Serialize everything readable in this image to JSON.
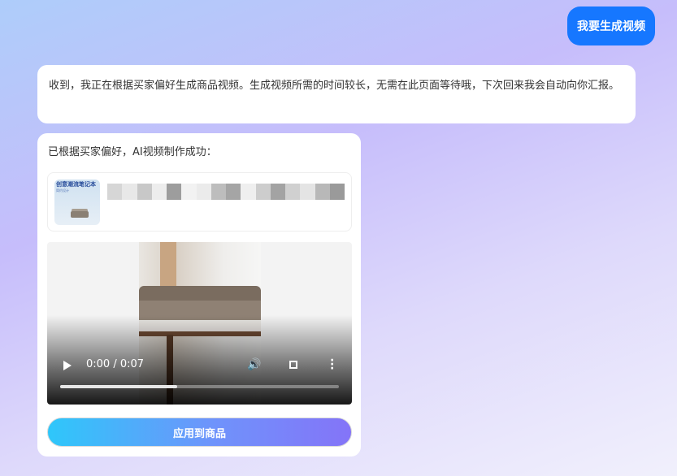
{
  "user_message": "我要生成视频",
  "bot_message": "收到，我正在根据买家偏好生成商品视频。生成视频所需的时间较长，无需在此页面等待哦，下次回来我会自动向你汇报。",
  "result_card": {
    "title": "已根据买家偏好，AI视频制作成功：",
    "product": {
      "thumbnail_title": "创意潮流笔记本",
      "thumbnail_subtitle": "简约设计",
      "name_mosaic_colors": [
        "#d6d6d6",
        "#e8e8e8",
        "#c8c8c8",
        "#ededed",
        "#9d9d9d",
        "#f2f2f2",
        "#ebebeb",
        "#bdbdbd",
        "#a5a5a5",
        "#efefef",
        "#cdcdcd",
        "#a3a3a3",
        "#d0d0d0",
        "#e4e4e4",
        "#b8b8b8",
        "#9a9a9a"
      ]
    },
    "video": {
      "time_display": "0:00 / 0:07",
      "progress": 0.42,
      "play_icon": "play-icon",
      "volume_icon": "volume-icon",
      "fullscreen_icon": "fullscreen-icon",
      "more_icon": "more-vertical-icon"
    },
    "apply_button": "应用到商品"
  },
  "colors": {
    "user_bubble": "#1677ff",
    "button_gradient_start": "#2ec7fa",
    "button_gradient_end": "#8474f8"
  }
}
